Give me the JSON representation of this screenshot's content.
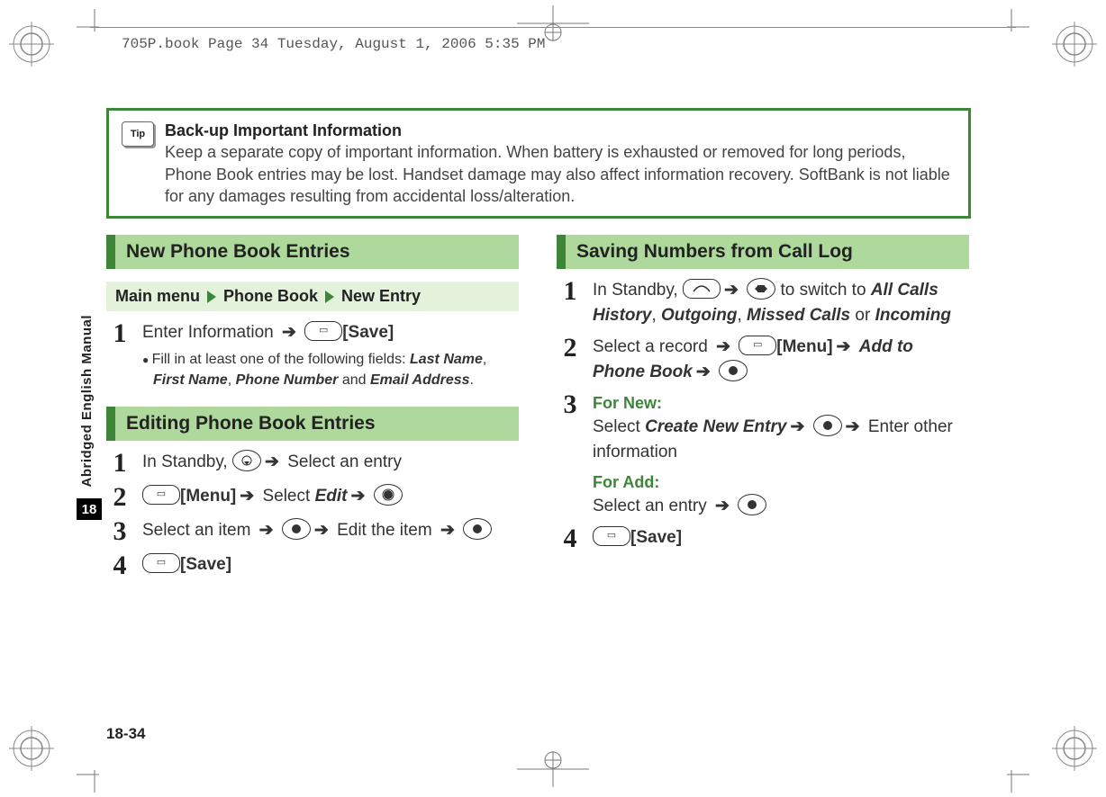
{
  "header": {
    "running": "705P.book  Page 34  Tuesday, August 1, 2006  5:35 PM"
  },
  "sidebar": {
    "text": "Abridged English Manual",
    "chapter": "18"
  },
  "page_number": "18-34",
  "tip": {
    "icon_label": "Tip",
    "title": "Back-up Important Information",
    "body": "Keep a separate copy of important information. When battery is exhausted or removed for long periods, Phone Book entries may be lost. Handset damage may also affect information recovery. SoftBank is not liable for any damages resulting from accidental loss/alteration."
  },
  "left": {
    "section1": {
      "title": "New Phone Book Entries",
      "breadcrumb": {
        "a": "Main menu",
        "b": "Phone Book",
        "c": "New Entry"
      },
      "step1_pre": "Enter Information ",
      "save_label": "[Save]",
      "note_pre": "Fill in at least one of the following fields: ",
      "f1": "Last Name",
      "f2": "First Name",
      "f3": "Phone Number",
      "f4": "Email Address"
    },
    "section2": {
      "title": "Editing Phone Book Entries",
      "s1_pre": "In Standby, ",
      "s1_post": " Select an entry",
      "s2_menu": "[Menu]",
      "s2_sel": " Select ",
      "s2_edit": "Edit",
      "s3_pre": "Select an item ",
      "s3_mid": " Edit the item ",
      "s4_save": "[Save]"
    }
  },
  "right": {
    "section": {
      "title": "Saving Numbers from Call Log",
      "s1_pre": "In Standby, ",
      "s1_mid": " to switch to ",
      "s1_a": "All Calls History",
      "s1_b": "Outgoing",
      "s1_c": "Missed Calls",
      "s1_d": "Incoming",
      "s1_or": " or ",
      "s2_pre": "Select a record ",
      "s2_menu": "[Menu]",
      "s2_add": "Add to Phone Book",
      "s3_fornew": "For New:",
      "s3_sel": "Select ",
      "s3_create": "Create New Entry",
      "s3_post": " Enter other information",
      "s3_foradd": "For Add:",
      "s3_seladd": "Select an entry ",
      "s4_save": "[Save]"
    }
  }
}
